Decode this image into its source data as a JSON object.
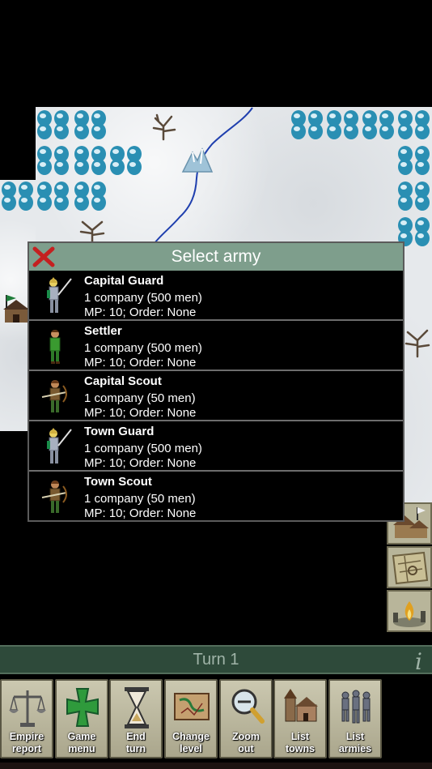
{
  "dialog": {
    "title": "Select army",
    "armies": [
      {
        "name": "Capital Guard",
        "size": "1 company (500 men)",
        "status": "MP: 10;  Order: None",
        "figure": "armored-knight-icon"
      },
      {
        "name": "Settler",
        "size": "1 company (500 men)",
        "status": "MP: 10;  Order: None",
        "figure": "green-settler-icon"
      },
      {
        "name": "Capital Scout",
        "size": "1 company (50 men)",
        "status": "MP: 10;  Order: None",
        "figure": "scout-archer-icon"
      },
      {
        "name": "Town Guard",
        "size": "1 company (500 men)",
        "status": "MP: 10;  Order: None",
        "figure": "armored-knight-icon"
      },
      {
        "name": "Town Scout",
        "size": "1 company (50 men)",
        "status": "MP: 10;  Order: None",
        "figure": "scout-archer-icon"
      }
    ]
  },
  "turn_bar": {
    "label": "Turn 1",
    "info": "i"
  },
  "toolbar": [
    {
      "line1": "Empire",
      "line2": "report",
      "icon": "scales-icon"
    },
    {
      "line1": "Game",
      "line2": "menu",
      "icon": "green-cross-icon"
    },
    {
      "line1": "End",
      "line2": "turn",
      "icon": "hourglass-icon"
    },
    {
      "line1": "Change",
      "line2": "level",
      "icon": "map-scroll-icon"
    },
    {
      "line1": "Zoom",
      "line2": "out",
      "icon": "magnifier-icon"
    },
    {
      "line1": "List",
      "line2": "towns",
      "icon": "town-icon"
    },
    {
      "line1": "List",
      "line2": "armies",
      "icon": "soldiers-icon"
    }
  ],
  "colors": {
    "dialog_header": "#7e9e8c",
    "turn_bar": "#2e4a3a",
    "snow": "#e6e9ec",
    "tree": "#2a8fb3",
    "river": "#1f3fae",
    "toolbar_button": "#bcb9a0"
  }
}
